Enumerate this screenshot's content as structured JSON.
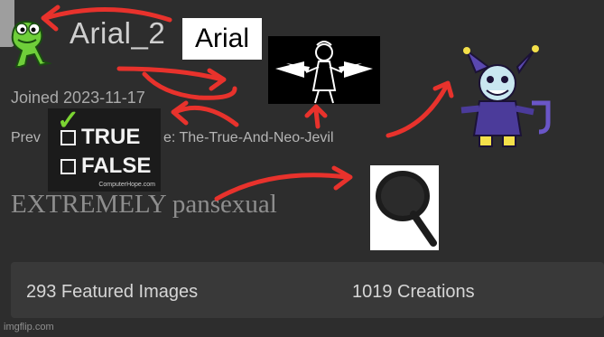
{
  "profile": {
    "username": "Arial_2",
    "joined": "Joined 2023-11-17",
    "previous_label": "Prev",
    "previous_value": "e: The-True-And-Neo-Jevil",
    "bio_prefix": "EXTREMELY",
    "bio_suffix": "pansexual"
  },
  "stats": {
    "featured": "293 Featured Images",
    "creations": "1019 Creations"
  },
  "overlays": {
    "arial_label": "Arial",
    "true_label": "TRUE",
    "false_label": "FALSE",
    "credit": "ComputerHope.com"
  },
  "watermark": "imgflip.com",
  "colors": {
    "background": "#2d2d2d",
    "stats_bar": "#393939",
    "arrow": "#e8322c"
  },
  "icons": [
    "frog-sticker-icon",
    "jevil-icon",
    "frying-pan-icon",
    "checkmark-icon"
  ]
}
